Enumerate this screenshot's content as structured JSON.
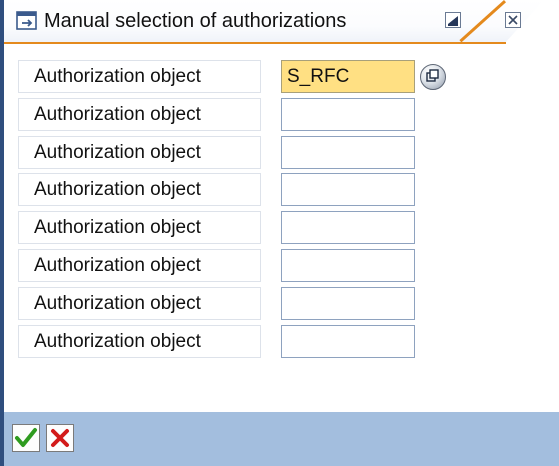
{
  "window": {
    "title": "Manual selection of authorizations",
    "minimize_icon": "minimize-icon",
    "close_icon": "close-icon"
  },
  "rows": [
    {
      "label": "Authorization object",
      "value": "S_RFC"
    },
    {
      "label": "Authorization object",
      "value": ""
    },
    {
      "label": "Authorization object",
      "value": ""
    },
    {
      "label": "Authorization object",
      "value": ""
    },
    {
      "label": "Authorization object",
      "value": ""
    },
    {
      "label": "Authorization object",
      "value": ""
    },
    {
      "label": "Authorization object",
      "value": ""
    },
    {
      "label": "Authorization object",
      "value": ""
    }
  ],
  "footer": {
    "ok_icon": "checkmark-icon",
    "cancel_icon": "cancel-icon"
  },
  "colors": {
    "accent": "#e48a1d",
    "frame": "#2f4e7e",
    "footer_bg": "#a3bede",
    "focused_field": "#ffe083"
  }
}
